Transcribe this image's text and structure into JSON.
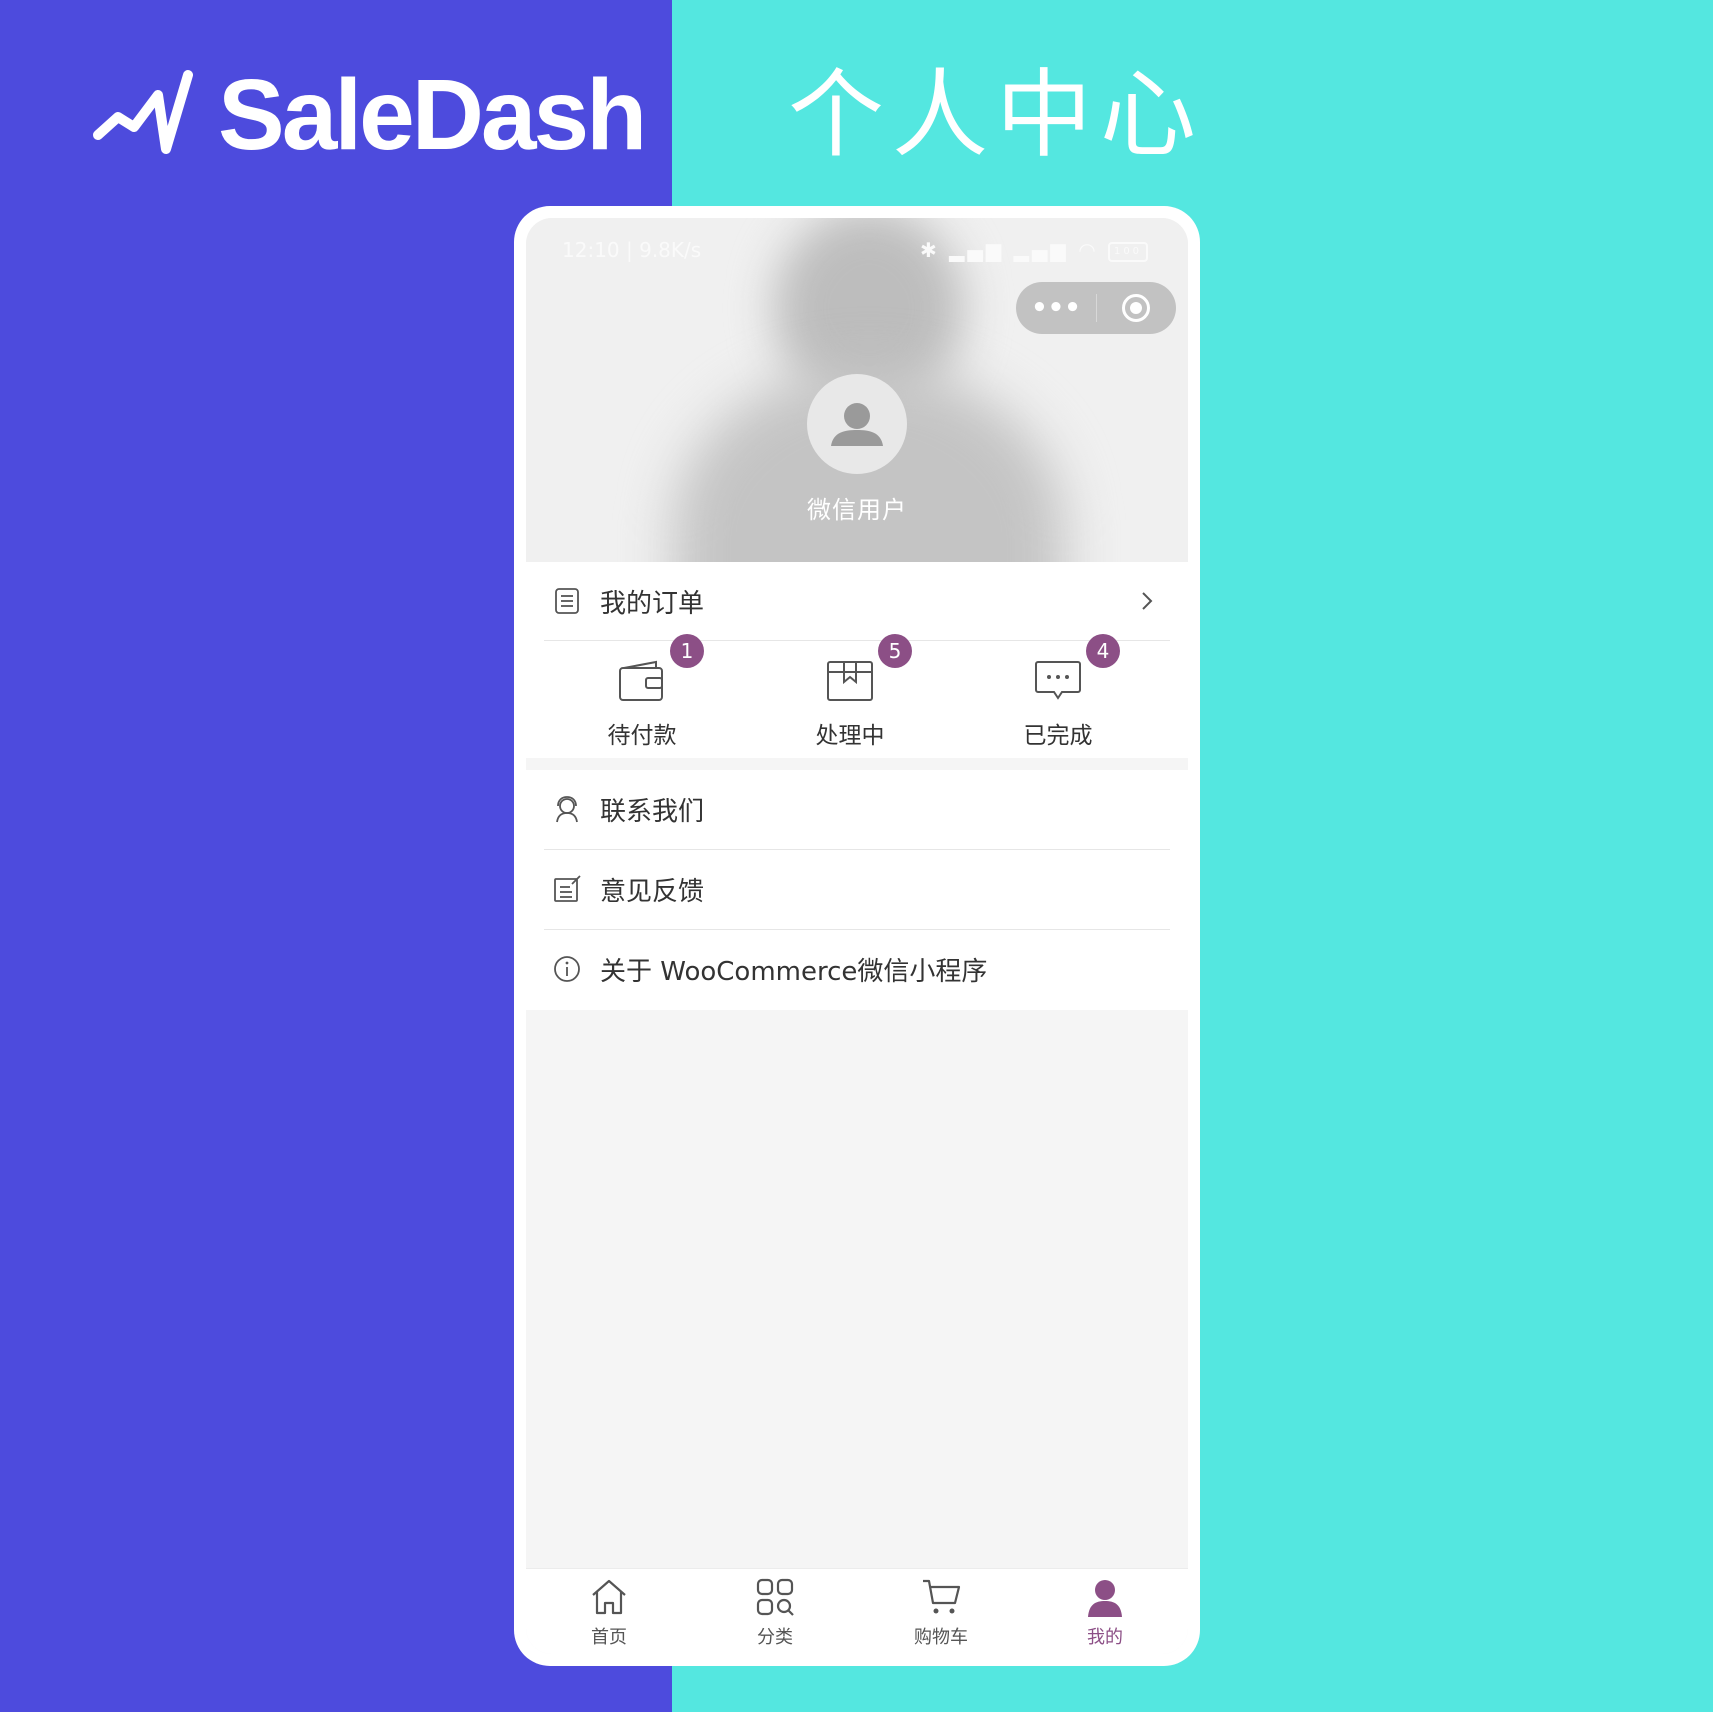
{
  "brand": {
    "name": "SaleDash",
    "logo_icon": "trend-line-icon"
  },
  "heading": "个人中心",
  "colors": {
    "left_panel": "#4d4bdd",
    "right_panel": "#54e7e0",
    "accent": "#8c4f86"
  },
  "status_bar": {
    "time": "12:10 | 9.8K/s",
    "battery": "100"
  },
  "profile": {
    "username": "微信用户",
    "avatar_icon": "user-avatar-icon"
  },
  "orders": {
    "title": "我的订单",
    "items": [
      {
        "label": "待付款",
        "count": "1",
        "icon": "wallet-icon"
      },
      {
        "label": "处理中",
        "count": "5",
        "icon": "package-icon"
      },
      {
        "label": "已完成",
        "count": "4",
        "icon": "message-icon"
      }
    ]
  },
  "menu": [
    {
      "label": "联系我们",
      "icon": "customer-service-icon"
    },
    {
      "label": "意见反馈",
      "icon": "feedback-icon"
    },
    {
      "label": "关于 WooCommerce微信小程序",
      "icon": "info-icon"
    }
  ],
  "tabs": [
    {
      "label": "首页",
      "icon": "home-icon"
    },
    {
      "label": "分类",
      "icon": "category-icon"
    },
    {
      "label": "购物车",
      "icon": "cart-icon"
    },
    {
      "label": "我的",
      "icon": "profile-icon",
      "active": true
    }
  ]
}
